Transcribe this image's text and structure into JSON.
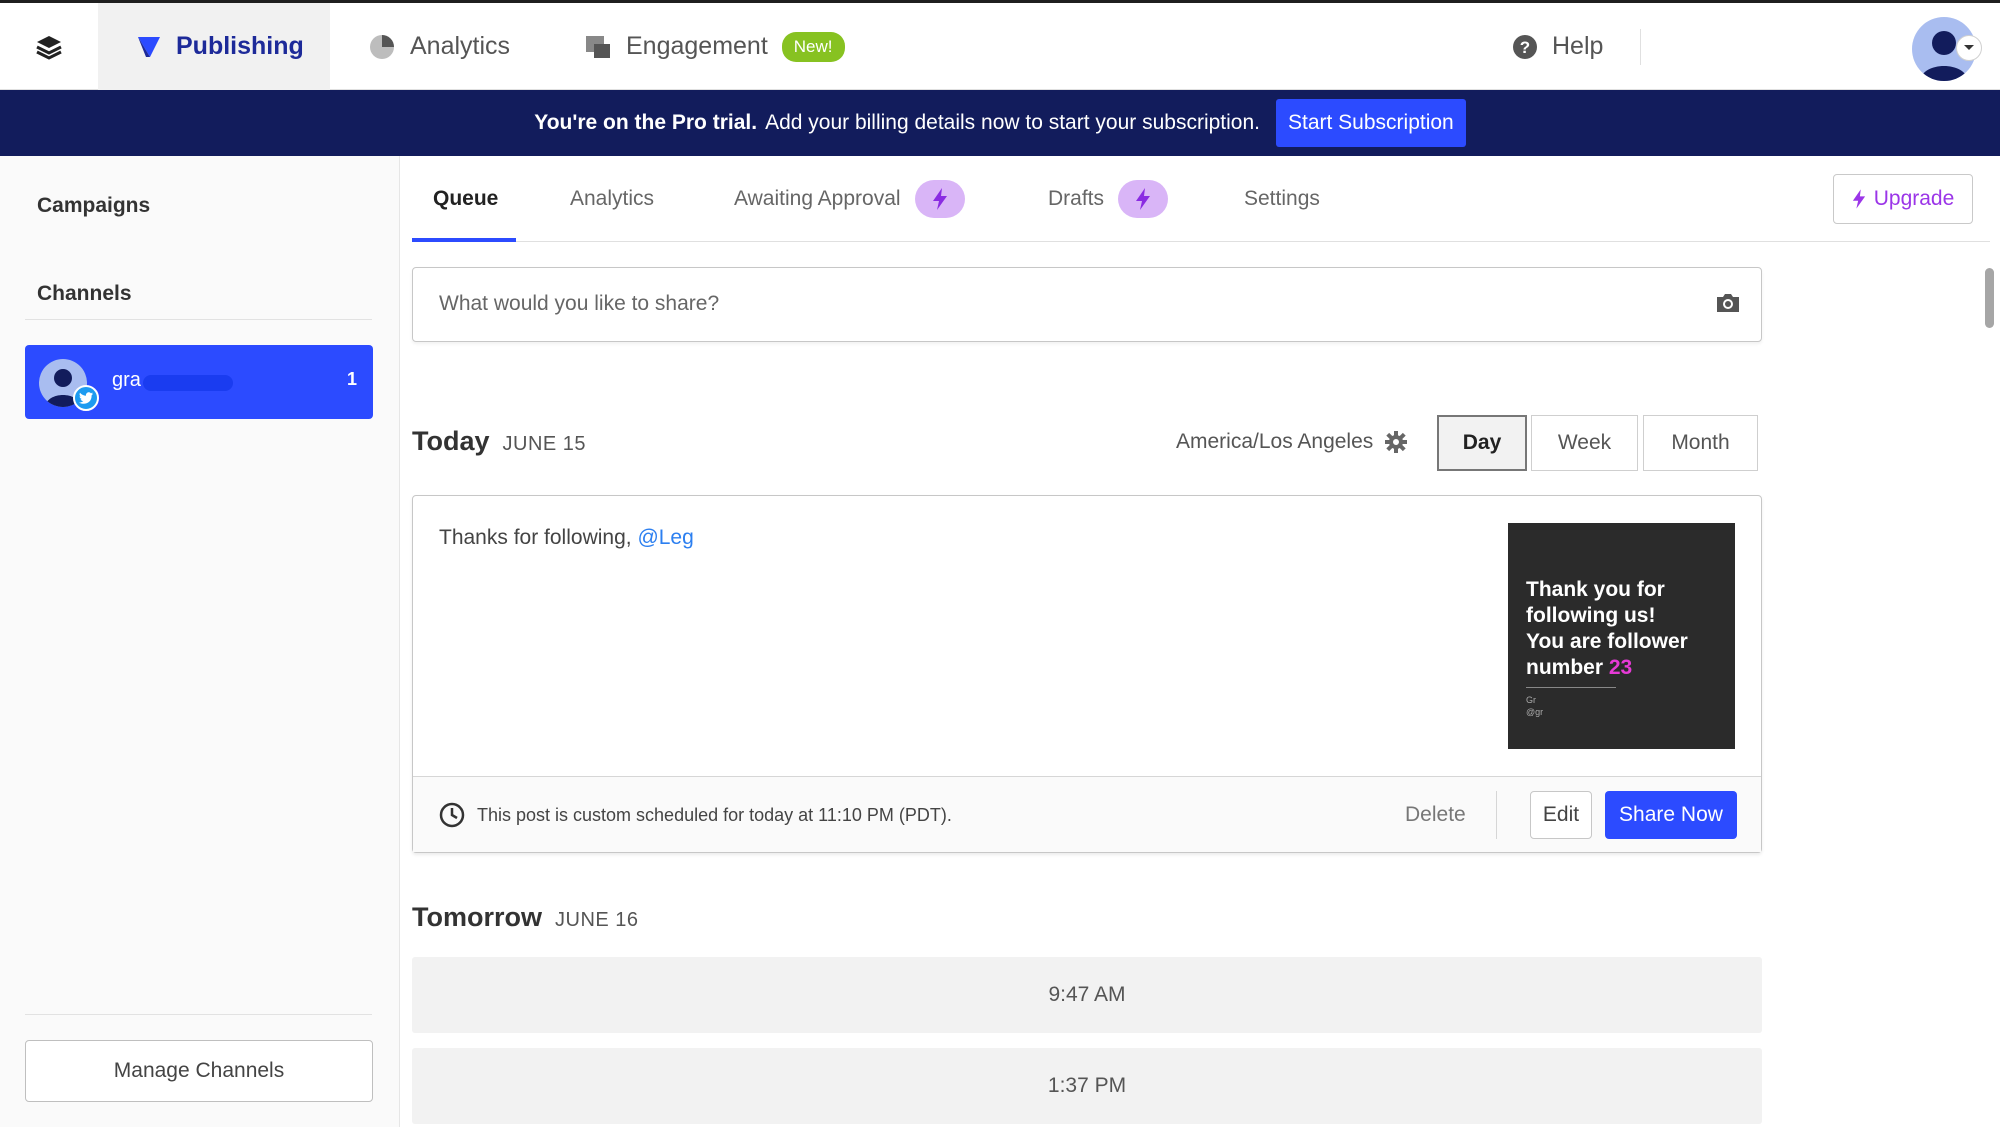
{
  "nav": {
    "publishing": "Publishing",
    "analytics": "Analytics",
    "engagement": "Engagement",
    "engagement_badge": "New!",
    "help": "Help"
  },
  "banner": {
    "bold": "You're on the Pro trial.",
    "text": "Add your billing details now to start your subscription.",
    "button": "Start Subscription"
  },
  "sidebar": {
    "campaigns": "Campaigns",
    "channels": "Channels",
    "channel": {
      "name": "gra",
      "count": "1"
    },
    "manage_button": "Manage Channels"
  },
  "tabs": {
    "queue": "Queue",
    "analytics": "Analytics",
    "awaiting_approval": "Awaiting Approval",
    "drafts": "Drafts",
    "settings": "Settings"
  },
  "upgrade_button": "Upgrade",
  "composer": {
    "placeholder": "What would you like to share?"
  },
  "today": {
    "label": "Today",
    "date": "JUNE 15"
  },
  "timezone": "America/Los Angeles",
  "view": {
    "day": "Day",
    "week": "Week",
    "month": "Month",
    "selected": "Day"
  },
  "post": {
    "text": "Thanks for following,",
    "mention": "@Leg",
    "image": {
      "line1": "Thank you for",
      "line2": "following us!",
      "line3": "You are follower",
      "line4": "number",
      "number": "23",
      "handle1": "Gr",
      "handle2": "@gr"
    },
    "schedule": "This post is custom scheduled for today at 11:10 PM (PDT).",
    "delete": "Delete",
    "edit": "Edit",
    "share_now": "Share Now"
  },
  "tomorrow": {
    "label": "Tomorrow",
    "date": "JUNE 16"
  },
  "slots": [
    "9:47 AM",
    "1:37 PM"
  ],
  "colors": {
    "primary": "#2c4bff",
    "banner_bg": "#121c5c",
    "accent_purple": "#9b35e8",
    "new_badge": "#87c221"
  }
}
